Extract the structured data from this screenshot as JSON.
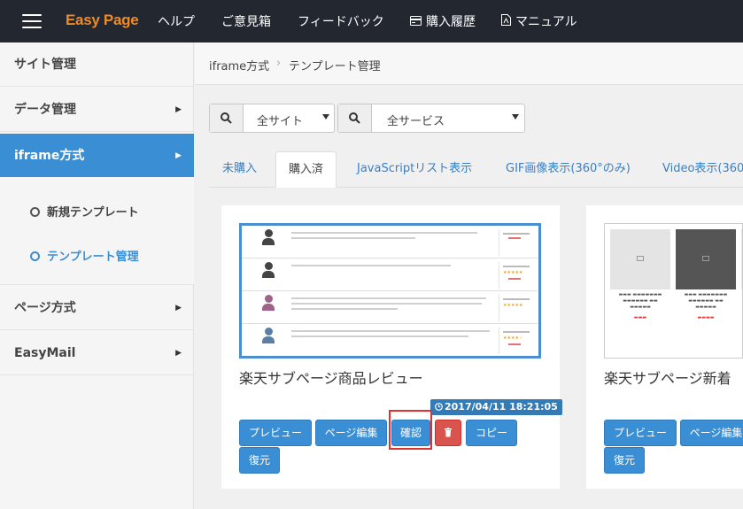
{
  "app": {
    "brand": "Easy Page",
    "nav": [
      {
        "label": "ヘルプ",
        "icon": ""
      },
      {
        "label": "ご意見箱",
        "icon": ""
      },
      {
        "label": "フィードバック",
        "icon": ""
      },
      {
        "label": "購入履歴",
        "icon": "credit-card-icon"
      },
      {
        "label": "マニュアル",
        "icon": "pdf-file-icon"
      }
    ]
  },
  "sidebar": {
    "items": [
      {
        "label": "サイト管理"
      },
      {
        "label": "データ管理"
      },
      {
        "label": "iframe方式"
      },
      {
        "label": "ページ方式"
      },
      {
        "label": "EasyMail"
      }
    ],
    "submenu": [
      {
        "label": "新規テンプレート"
      },
      {
        "label": "テンプレート管理"
      }
    ]
  },
  "breadcrumb": {
    "parent": "iframe方式",
    "separator": "›",
    "current": "テンプレート管理"
  },
  "filters": {
    "site": "全サイト",
    "service": "全サービス"
  },
  "tabs": [
    {
      "label": "未購入"
    },
    {
      "label": "購入済"
    },
    {
      "label": "JavaScriptリスト表示"
    },
    {
      "label": "GIF画像表示(360°のみ)"
    },
    {
      "label": "Video表示(360"
    }
  ],
  "cards": [
    {
      "title": "楽天サブページ商品レビュー",
      "date": "2017/04/11 18:21:05",
      "buttons": {
        "preview": "プレビュー",
        "edit": "ページ編集",
        "confirm": "確認",
        "copy": "コピー",
        "restore": "復元"
      }
    },
    {
      "title": "楽天サブページ新着",
      "buttons": {
        "preview": "プレビュー",
        "edit": "ページ編集",
        "restore": "復元"
      }
    }
  ],
  "colors": {
    "topbar": "#222730",
    "brand": "#f08a24",
    "accent": "#3a8ed4",
    "danger": "#d9534f",
    "highlight": "#e03131"
  }
}
